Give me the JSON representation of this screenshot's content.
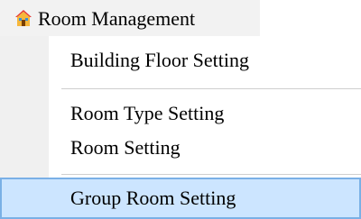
{
  "menu": {
    "title": "Room Management",
    "title_icon": "home-icon",
    "items": [
      {
        "label": "Building  Floor Setting",
        "selected": false
      },
      {
        "label": "Room Type Setting",
        "selected": false
      },
      {
        "label": "Room Setting",
        "selected": false
      },
      {
        "label": "Group Room Setting",
        "selected": true
      }
    ]
  },
  "colors": {
    "gutter": "#f0f0f0",
    "selection_fill": "#cce5ff",
    "selection_border": "#7ab0e6",
    "separator": "#cfcfcf",
    "icon_roof": "#e53935",
    "icon_house": "#f6b73c"
  }
}
